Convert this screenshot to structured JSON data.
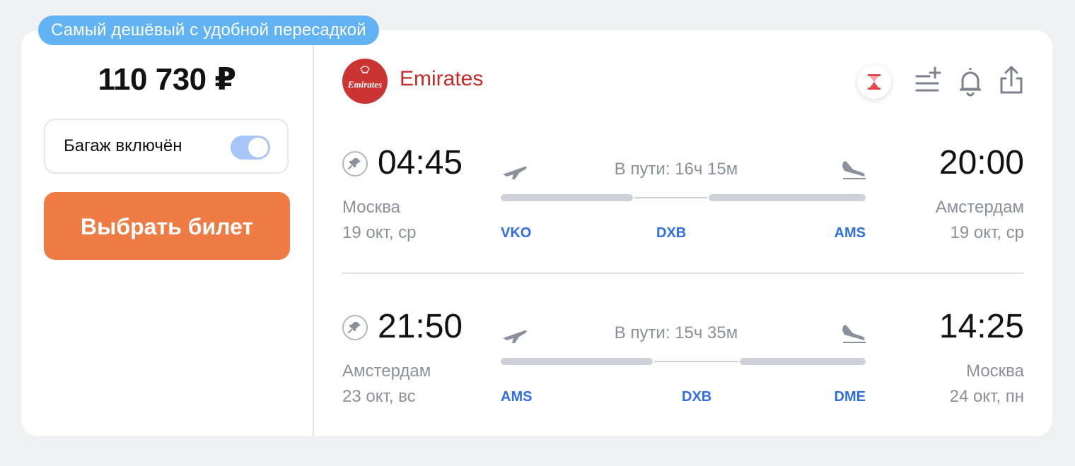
{
  "badge": "Самый дешёвый с удобной пересадкой",
  "price": "110 730 ₽",
  "baggage": {
    "label": "Багаж включён",
    "enabled": true
  },
  "select_button": "Выбрать билет",
  "airline": {
    "name": "Emirates",
    "logo_text": "Emirates",
    "logo_color": "#cc3333"
  },
  "actions": {
    "hourglass": "hourglass-icon",
    "add_to_list": "add-to-list-icon",
    "subscribe": "bell-icon",
    "share": "share-icon"
  },
  "flights": [
    {
      "depart_time": "04:45",
      "depart_city": "Москва",
      "depart_date": "19 окт, ср",
      "duration": "В пути: 16ч 15м",
      "airports": [
        "VKO",
        "DXB",
        "AMS"
      ],
      "arrive_time": "20:00",
      "arrive_city": "Амстердам",
      "arrive_date": "19 окт, ср"
    },
    {
      "depart_time": "21:50",
      "depart_city": "Амстердам",
      "depart_date": "23 окт, вс",
      "duration": "В пути: 15ч 35м",
      "airports": [
        "AMS",
        "DXB",
        "DME"
      ],
      "arrive_time": "14:25",
      "arrive_city": "Москва",
      "arrive_date": "24 окт, пн"
    }
  ],
  "colors": {
    "accent_orange": "#f07c45",
    "badge_blue": "#61b3f4",
    "code_blue": "#2f6ee6",
    "toggle_blue": "#a8c5f8"
  }
}
